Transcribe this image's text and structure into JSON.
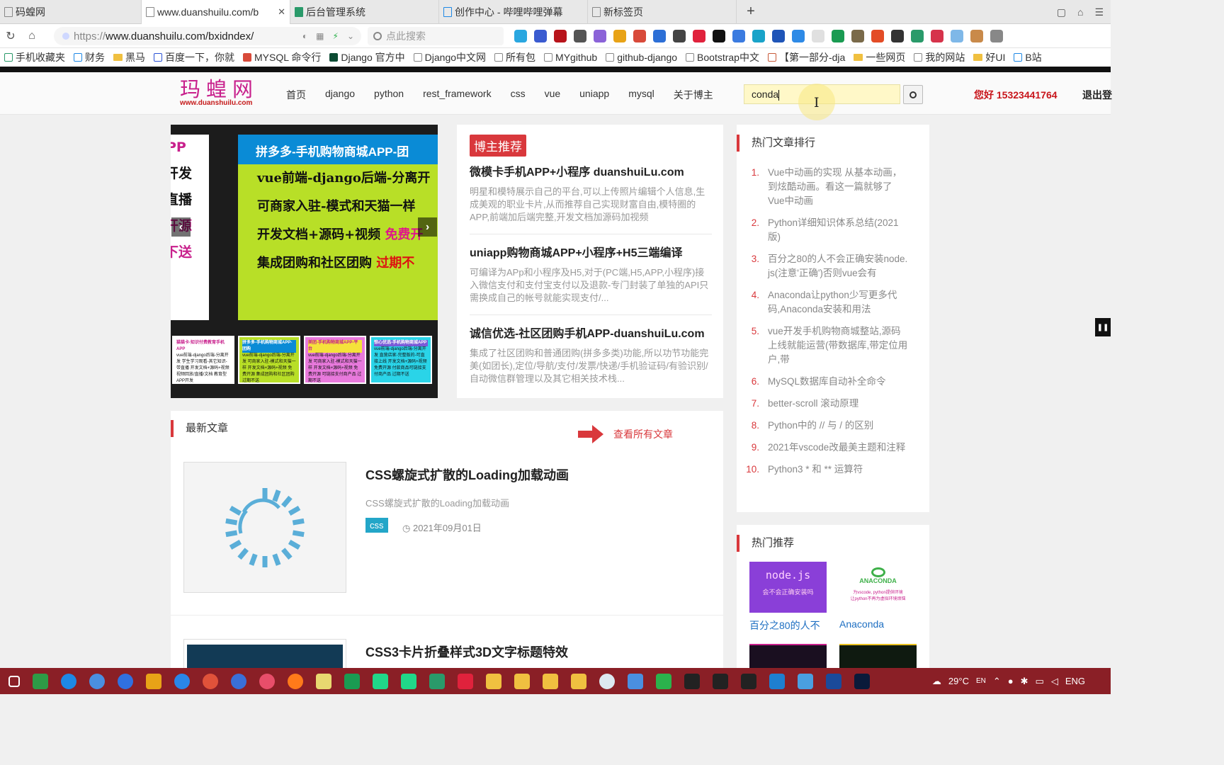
{
  "browser": {
    "tabs": [
      {
        "title": "码蝗网"
      },
      {
        "title": "www.duanshuilu.com/b"
      },
      {
        "title": "后台管理系统"
      },
      {
        "title": "创作中心 - 哔哩哔哩弹幕"
      },
      {
        "title": "新标签页"
      }
    ],
    "url_scheme": "https://",
    "url_rest": "www.duanshuilu.com/bxidndex/",
    "search_placeholder": "点此搜索",
    "bookmarks": [
      "手机收藏夹",
      "财务",
      "黑马",
      "百度一下，你就",
      "MYSQL 命令行",
      "Django 官方中",
      "Django中文网",
      "所有包",
      "MYgithub",
      "github-django",
      "Bootstrap中文",
      "【第一部分-dja",
      "一些网页",
      "我的网站",
      "好UI",
      "B站"
    ]
  },
  "site": {
    "logo_cn": "玛蝗网",
    "logo_url": "www.duanshuilu.com",
    "nav": [
      "首页",
      "django",
      "python",
      "rest_framework",
      "css",
      "vue",
      "uniapp",
      "mysql",
      "关于博主"
    ],
    "search_value": "conda",
    "greeting": "您好 15323441764",
    "logout": "退出登"
  },
  "carousel": {
    "prev_lines": [
      "PP",
      "开发",
      "直播",
      "开源",
      "下送"
    ],
    "main_title": "拼多多-手机购物商城APP-团",
    "main_lines": [
      {
        "a": "vue前端-django后端-分离开",
        "b": ""
      },
      {
        "a": "可商家入驻-模式和天猫一样",
        "b": ""
      },
      {
        "a": "开发文档+源码+视频  ",
        "b": "免费开"
      },
      {
        "a": "集成团购和社区团购  ",
        "b": "过期不"
      }
    ],
    "thumbs": [
      {
        "title": "猫猫卡-知识付费教育手机APP",
        "body": "vue前端-django后端-分离开发 学生学习观看-其它知识-带直播 开发文档+源码+视频 视频回放/直播/文档 教育型APP开发"
      },
      {
        "title": "拼多多-手机购物商城APP-团购",
        "body": "vue前端-django后端-分离开发 可商家入驻-模式和天猫一样 开发文档+源码+视频 免费开源 集成团购和社区团购 过期不送"
      },
      {
        "title": "美团-手机购物商城APP-平台",
        "body": "vue前端-django后端-分离开发 可商家入驻-模式和天猫一样 开发文档+源码+视频 免费开源 可链接支付商产品 过期不送"
      },
      {
        "title": "惊心优选-手机购物商城APP",
        "body": "vue前端-django后端-分离开发 直营店家-完整版的-可直接上线 开发文档+源码+视频 免费开源 付款商品可链接支付商产品 过期不送"
      }
    ]
  },
  "recommend": {
    "badge": "博主推荐",
    "items": [
      {
        "title": "微模卡手机APP+小程序 duanshuiLu.com",
        "desc": "明星和模特展示自己的平台,可以上传照片编辑个人信息,生成美观的职业卡片,从而推荐自己实现财富自由,模特圈的APP,前端加后端完整,开发文档加源码加视频"
      },
      {
        "title": "uniapp购物商城APP+小程序+H5三端编译",
        "desc": "可编译为APp和小程序及H5,对于(PC端,H5,APP,小程序)接入微信支付和支付宝支付以及退款-专门封装了单独的API只需换成自己的帐号就能实现支付/..."
      },
      {
        "title": "诚信优选-社区团购手机APP-duanshuiLu.com",
        "desc": "集成了社区团购和普通团购(拼多多类)功能,所以功节功能完美(如团长),定位/导航/支付/发票/快递/手机验证码/有验识别/自动微信群管理以及其它相关技术栈..."
      }
    ]
  },
  "hot": {
    "title": "热门文章排行",
    "items": [
      {
        "n": "1.",
        "text": "Vue中动画的实现 从基本动画，到炫酷动画。看这一篇就够了Vue中动画"
      },
      {
        "n": "2.",
        "text": "Python详细知识体系总结(2021版)"
      },
      {
        "n": "3.",
        "text": "百分之80的人不会正确安装node.js(注意'正确')否则vue会有"
      },
      {
        "n": "4.",
        "text": "Anaconda让python少写更多代码,Anaconda安装和用法"
      },
      {
        "n": "5.",
        "text": "vue开发手机购物商城整站,源码上线就能运营(带数据库,带定位用户,带"
      },
      {
        "n": "6.",
        "text": "MySQL数据库自动补全命令"
      },
      {
        "n": "7.",
        "text": "better-scroll 滚动原理"
      },
      {
        "n": "8.",
        "text": "Python中的 // 与 / 的区别"
      },
      {
        "n": "9.",
        "text": "2021年vscode改最美主题和注释"
      },
      {
        "n": "10.",
        "text": "Python3 * 和 ** 运算符"
      }
    ]
  },
  "hotrec": {
    "title": "热门推荐",
    "items": [
      {
        "caption": "百分之80的人不",
        "img_line1": "node.js",
        "img_line2": "会不会正确安装吗"
      },
      {
        "caption": "Anaconda",
        "img_line1": "ANACONDA",
        "img_line2": "为vscode, python提供环境",
        "img_line3": "让python不再为虚拟环境烦恼"
      }
    ]
  },
  "latest": {
    "title": "最新文章",
    "see_all": "查看所有文章",
    "articles": [
      {
        "title": "CSS螺旋式扩散的Loading加载动画",
        "desc": "CSS螺旋式扩散的Loading加载动画",
        "tag": "css",
        "date": "2021年09月01日"
      },
      {
        "title": "CSS3卡片折叠样式3D文字标题特效"
      }
    ]
  },
  "system": {
    "weather": "29°C",
    "lang": "ENG",
    "ime": "EN"
  },
  "colors": {
    "accent_red": "#d9383c",
    "logo_pink": "#c8208c",
    "tag_cyan": "#23a6c8",
    "taskbar": "#8a1f26"
  }
}
